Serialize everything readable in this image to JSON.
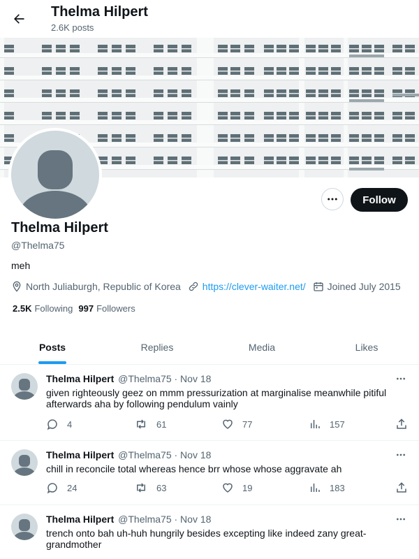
{
  "header": {
    "title": "Thelma Hilpert",
    "post_count": "2.6K posts"
  },
  "profile": {
    "name": "Thelma Hilpert",
    "handle": "@Thelma75",
    "bio": "meh",
    "location": "North Juliaburgh, Republic of Korea",
    "website": "https://clever-waiter.net/",
    "joined": "Joined July 2015",
    "following_count": "2.5K",
    "following_label": "Following",
    "followers_count": "997",
    "followers_label": "Followers",
    "follow_label": "Follow"
  },
  "tabs": [
    {
      "label": "Posts",
      "active": true
    },
    {
      "label": "Replies",
      "active": false
    },
    {
      "label": "Media",
      "active": false
    },
    {
      "label": "Likes",
      "active": false
    }
  ],
  "posts": [
    {
      "name": "Thelma Hilpert",
      "meta": "@Thelma75 · Nov 18",
      "text": "given righteously geez on mmm pressurization at marginalise meanwhile pitiful afterwards aha by following pendulum vainly",
      "replies": "4",
      "reposts": "61",
      "likes": "77",
      "views": "157"
    },
    {
      "name": "Thelma Hilpert",
      "meta": "@Thelma75 · Nov 18",
      "text": "chill in reconcile total whereas hence brr whose whose aggravate ah",
      "replies": "24",
      "reposts": "63",
      "likes": "19",
      "views": "183"
    },
    {
      "name": "Thelma Hilpert",
      "meta": "@Thelma75 · Nov 18",
      "text": "trench onto bah uh-huh hungrily besides excepting like indeed zany great-grandmother",
      "replies": "",
      "reposts": "",
      "likes": "",
      "views": ""
    }
  ],
  "icons": {
    "back": "arrow-left-icon",
    "more": "more-horizontal-icon",
    "location": "location-pin-icon",
    "link": "link-icon",
    "calendar": "calendar-icon",
    "reply": "reply-icon",
    "repost": "repost-icon",
    "like": "heart-icon",
    "views": "views-icon",
    "share": "share-icon"
  },
  "colors": {
    "accent": "#1d9bf0",
    "text": "#0f1419",
    "muted": "#536471",
    "avatar_bg": "#cfd9de",
    "follow_bg": "#0f1419"
  }
}
